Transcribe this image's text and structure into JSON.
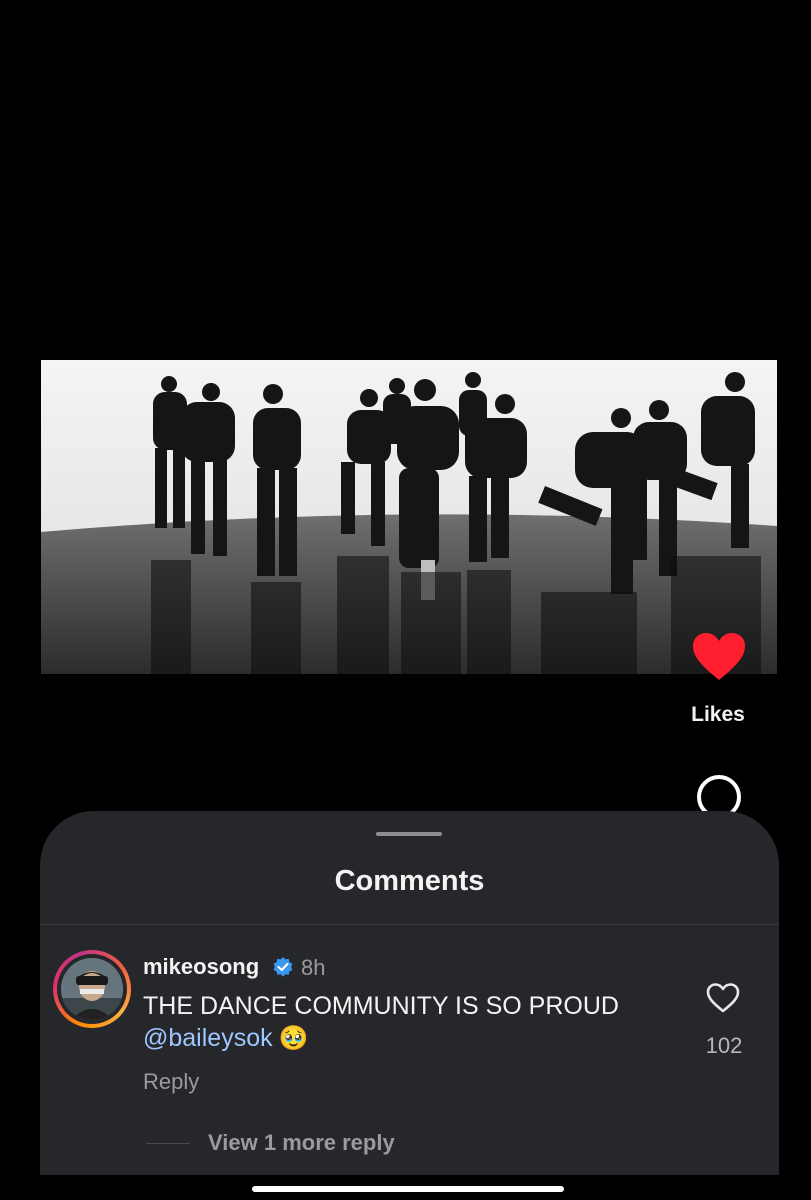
{
  "video": {
    "description_icon": "dance-video-thumbnail"
  },
  "actions": {
    "like_icon": "heart-filled-icon",
    "like_color": "#ff1f2f",
    "likes_label": "Likes",
    "comment_icon": "comment-bubble-icon"
  },
  "comments_sheet": {
    "title": "Comments",
    "comments": [
      {
        "username": "mikeosong",
        "verified": true,
        "timestamp": "8h",
        "text": "THE DANCE COMMUNITY IS SO PROUD",
        "mention": "@baileysok",
        "emoji": "🥹",
        "like_count": "102",
        "reply_label": "Reply",
        "view_replies_label": "View 1 more reply"
      }
    ]
  },
  "colors": {
    "background": "#000000",
    "sheet": "#26272b",
    "mention": "#9fc6ff",
    "verified": "#3897f0"
  }
}
